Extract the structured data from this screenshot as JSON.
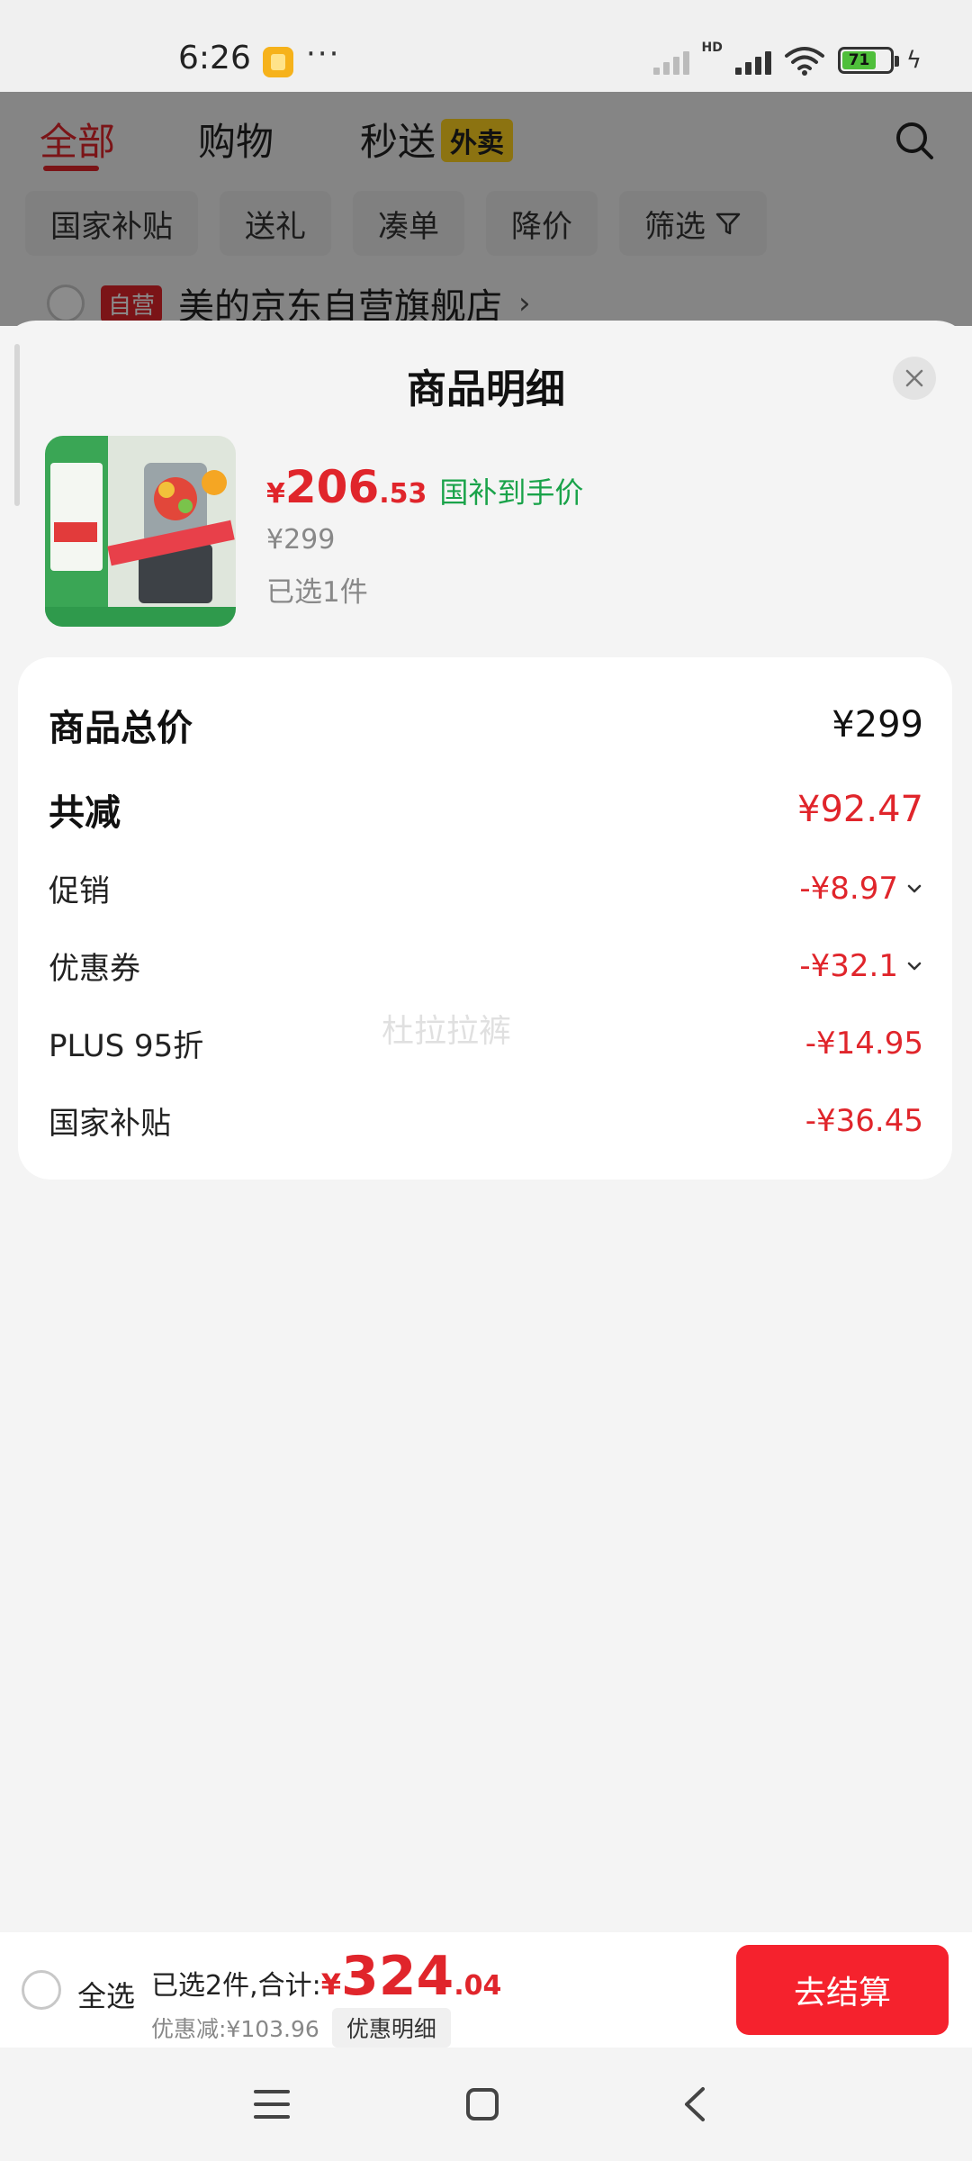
{
  "status_bar": {
    "time": "6:26",
    "dots": "···",
    "hd": "HD",
    "battery": "71",
    "icons": [
      "note-icon",
      "signal-icon",
      "wifi-icon",
      "battery-icon",
      "charging-icon"
    ]
  },
  "tabs": {
    "all": "全部",
    "shopping": "购物",
    "fast": "秒送",
    "waimai": "外卖"
  },
  "filters": [
    "国家补贴",
    "送礼",
    "凑单",
    "降价",
    "筛选"
  ],
  "store": {
    "badge": "自营",
    "name": "美的京东自营旗舰店",
    "arrow": "›"
  },
  "sheet": {
    "title": "商品明细",
    "product": {
      "price_yen": "¥",
      "price_int": "206",
      "price_dec": ".53",
      "price_tag": "国补到手价",
      "original_price": "¥299",
      "selected_count": "已选1件"
    },
    "summary": {
      "total_label": "商品总价",
      "total_value": "¥299",
      "reduce_label": "共减",
      "reduce_value": "¥92.47",
      "promo_label": "促销",
      "promo_value": "-¥8.97",
      "coupon_label": "优惠券",
      "coupon_value": "-¥32.1",
      "plus_label": "PLUS 95折",
      "plus_value": "-¥14.95",
      "subsidy_label": "国家补贴",
      "subsidy_value": "-¥36.45"
    },
    "watermark": "杜拉拉裤"
  },
  "checkout": {
    "select_all": "全选",
    "summary_prefix": "已选2件,合计:",
    "total_yen": "¥",
    "total_int": "324",
    "total_dec": ".04",
    "discount": "优惠减:¥103.96",
    "detail_button": "优惠明细",
    "submit": "去结算"
  },
  "colors": {
    "accent_red": "#e0252b",
    "button_red": "#f5222d",
    "subsidy_green": "#1aa34a"
  }
}
